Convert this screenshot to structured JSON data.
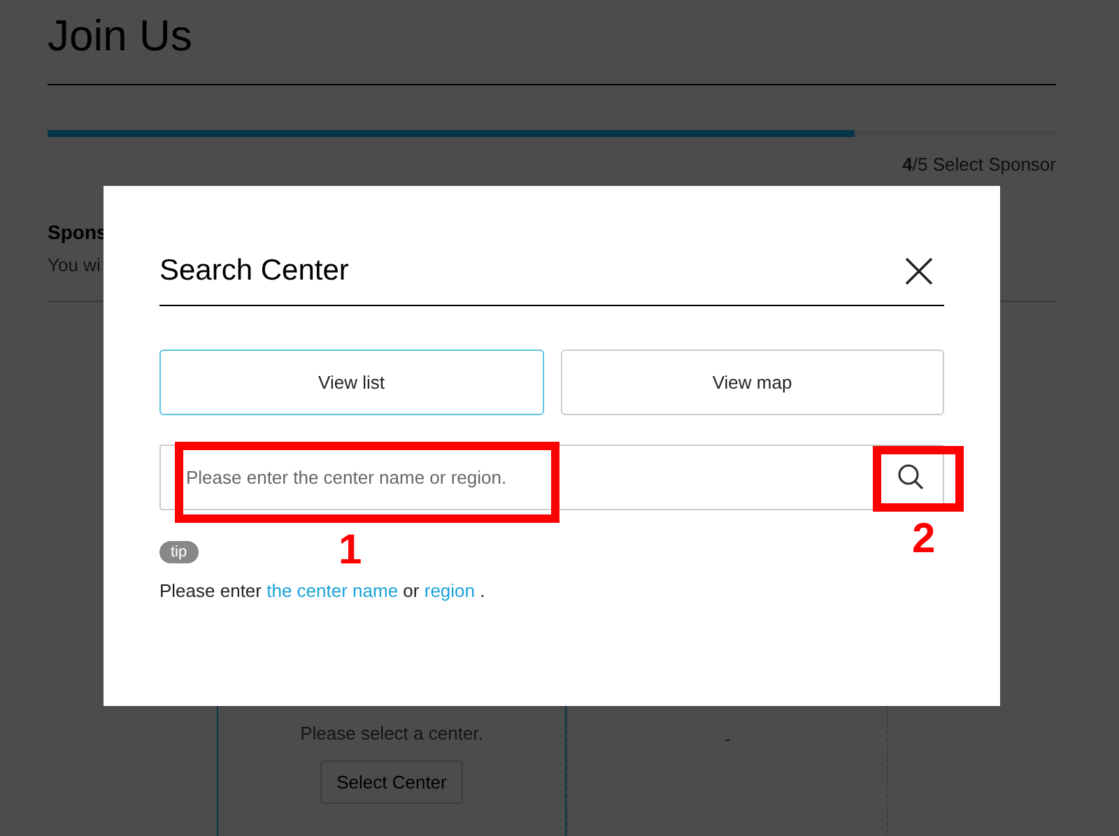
{
  "page": {
    "title": "Join Us",
    "progress": {
      "level": 0.8,
      "label": "**4**/5 Select Sponsor"
    },
    "section": {
      "title": "Spons",
      "subtitle": "You wi"
    },
    "cards": [
      {
        "kind": "select",
        "text": "Please select a center.",
        "button": "Select Center"
      },
      {
        "kind": "value",
        "text": "-"
      }
    ]
  },
  "dialog": {
    "title": "Search Center",
    "tabs": [
      {
        "label": "View list",
        "selected": true
      },
      {
        "label": "View map",
        "selected": false
      }
    ],
    "search": {
      "placeholder": "Please enter the center name or region."
    },
    "tip": {
      "badge": "tip",
      "parts": [
        {
          "kind": "text",
          "text": "Please enter "
        },
        {
          "kind": "link",
          "text": "the center name"
        },
        {
          "kind": "text",
          "text": " or "
        },
        {
          "kind": "link",
          "text": "region"
        },
        {
          "kind": "text",
          "text": " ."
        }
      ]
    }
  },
  "annotations": [
    {
      "kind": "field",
      "label": "1"
    },
    {
      "kind": "button",
      "label": "2"
    }
  ]
}
